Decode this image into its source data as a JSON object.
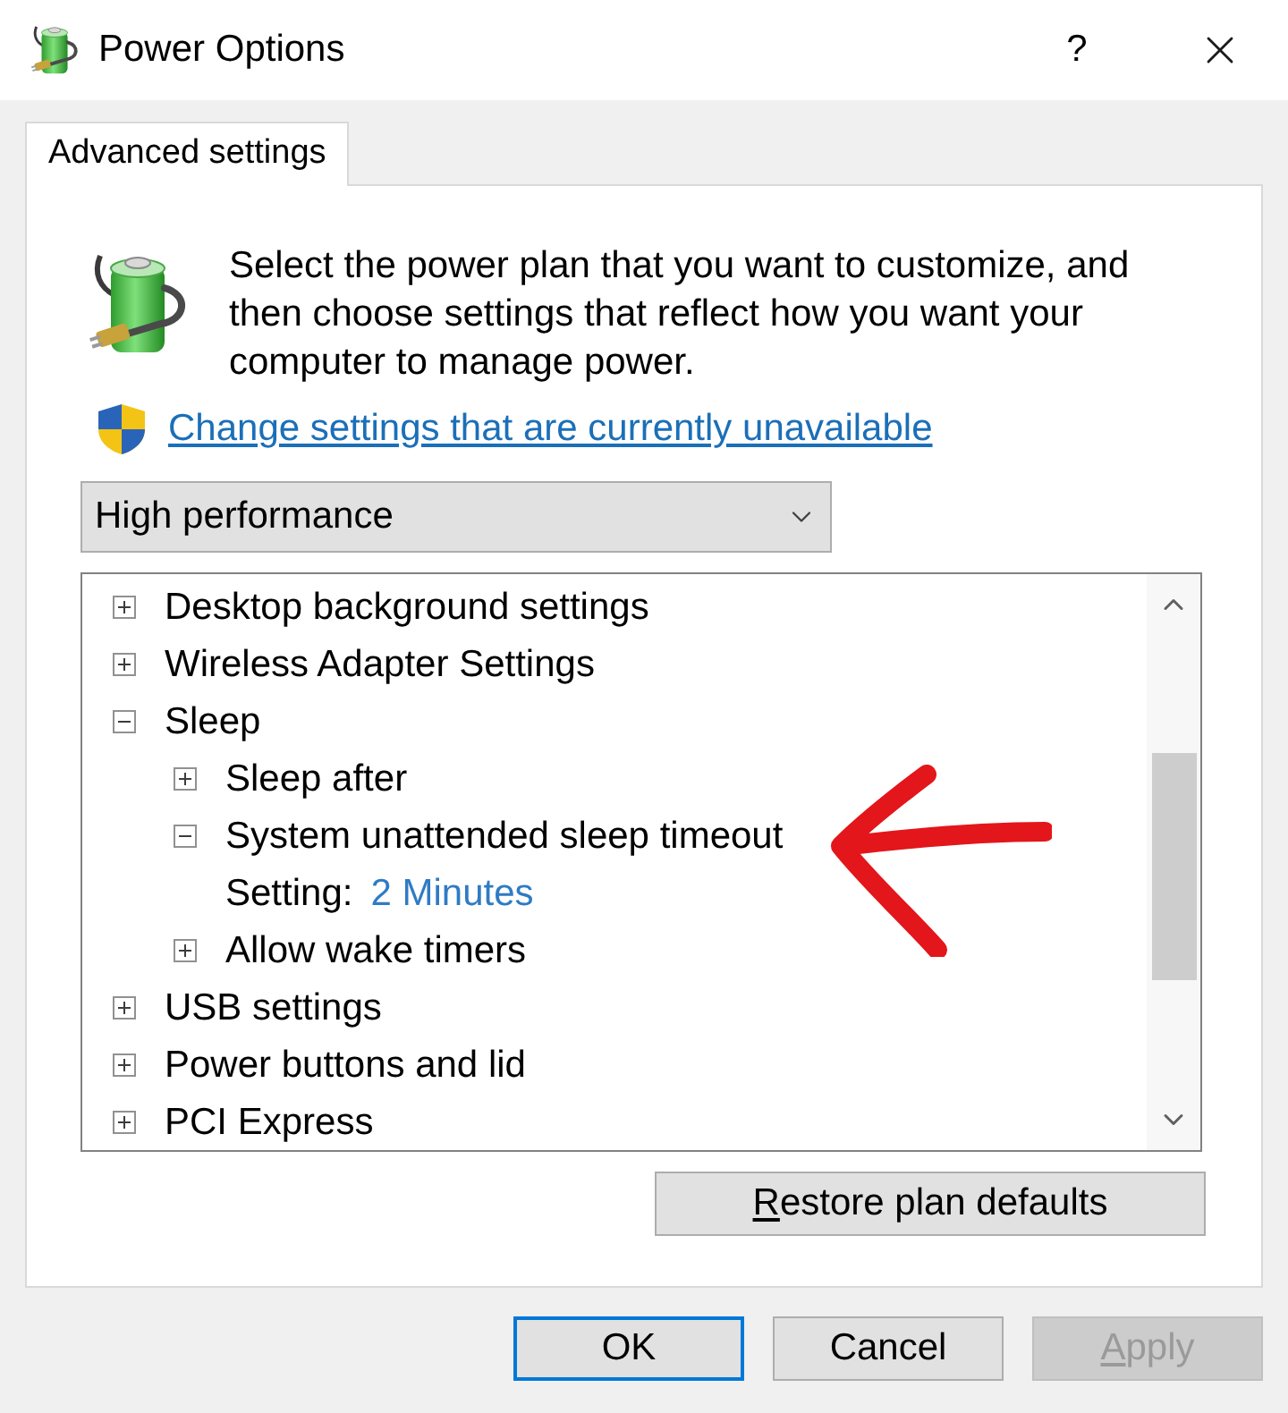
{
  "window": {
    "title": "Power Options",
    "help_button": "?"
  },
  "tabs": [
    {
      "label": "Advanced settings",
      "selected": true
    }
  ],
  "intro": {
    "text": "Select the power plan that you want to customize, and then choose settings that reflect how you want your computer to manage power.",
    "link": "Change settings that are currently unavailable"
  },
  "plan_dropdown": {
    "value": "High performance"
  },
  "settings_tree": [
    {
      "kind": "node",
      "label": "Desktop background settings",
      "expanded": false
    },
    {
      "kind": "node",
      "label": "Wireless Adapter Settings",
      "expanded": false
    },
    {
      "kind": "node",
      "label": "Sleep",
      "expanded": true,
      "children": [
        {
          "kind": "node",
          "label": "Sleep after",
          "expanded": false
        },
        {
          "kind": "node",
          "label": "System unattended sleep timeout",
          "expanded": true,
          "children": [
            {
              "kind": "setting",
              "label": "Setting:",
              "value": "2 Minutes"
            }
          ]
        },
        {
          "kind": "node",
          "label": "Allow wake timers",
          "expanded": false
        }
      ]
    },
    {
      "kind": "node",
      "label": "USB settings",
      "expanded": false
    },
    {
      "kind": "node",
      "label": "Power buttons and lid",
      "expanded": false
    },
    {
      "kind": "node",
      "label": "PCI Express",
      "expanded": false
    }
  ],
  "restore_button": {
    "label": "Restore plan defaults",
    "access_key_underlined": true
  },
  "buttons": [
    {
      "label": "OK",
      "default": true,
      "disabled": false,
      "access_key_underlined": false
    },
    {
      "label": "Cancel",
      "default": false,
      "disabled": false,
      "access_key_underlined": false
    },
    {
      "label": "Apply",
      "default": false,
      "disabled": true,
      "access_key_underlined": true
    }
  ]
}
